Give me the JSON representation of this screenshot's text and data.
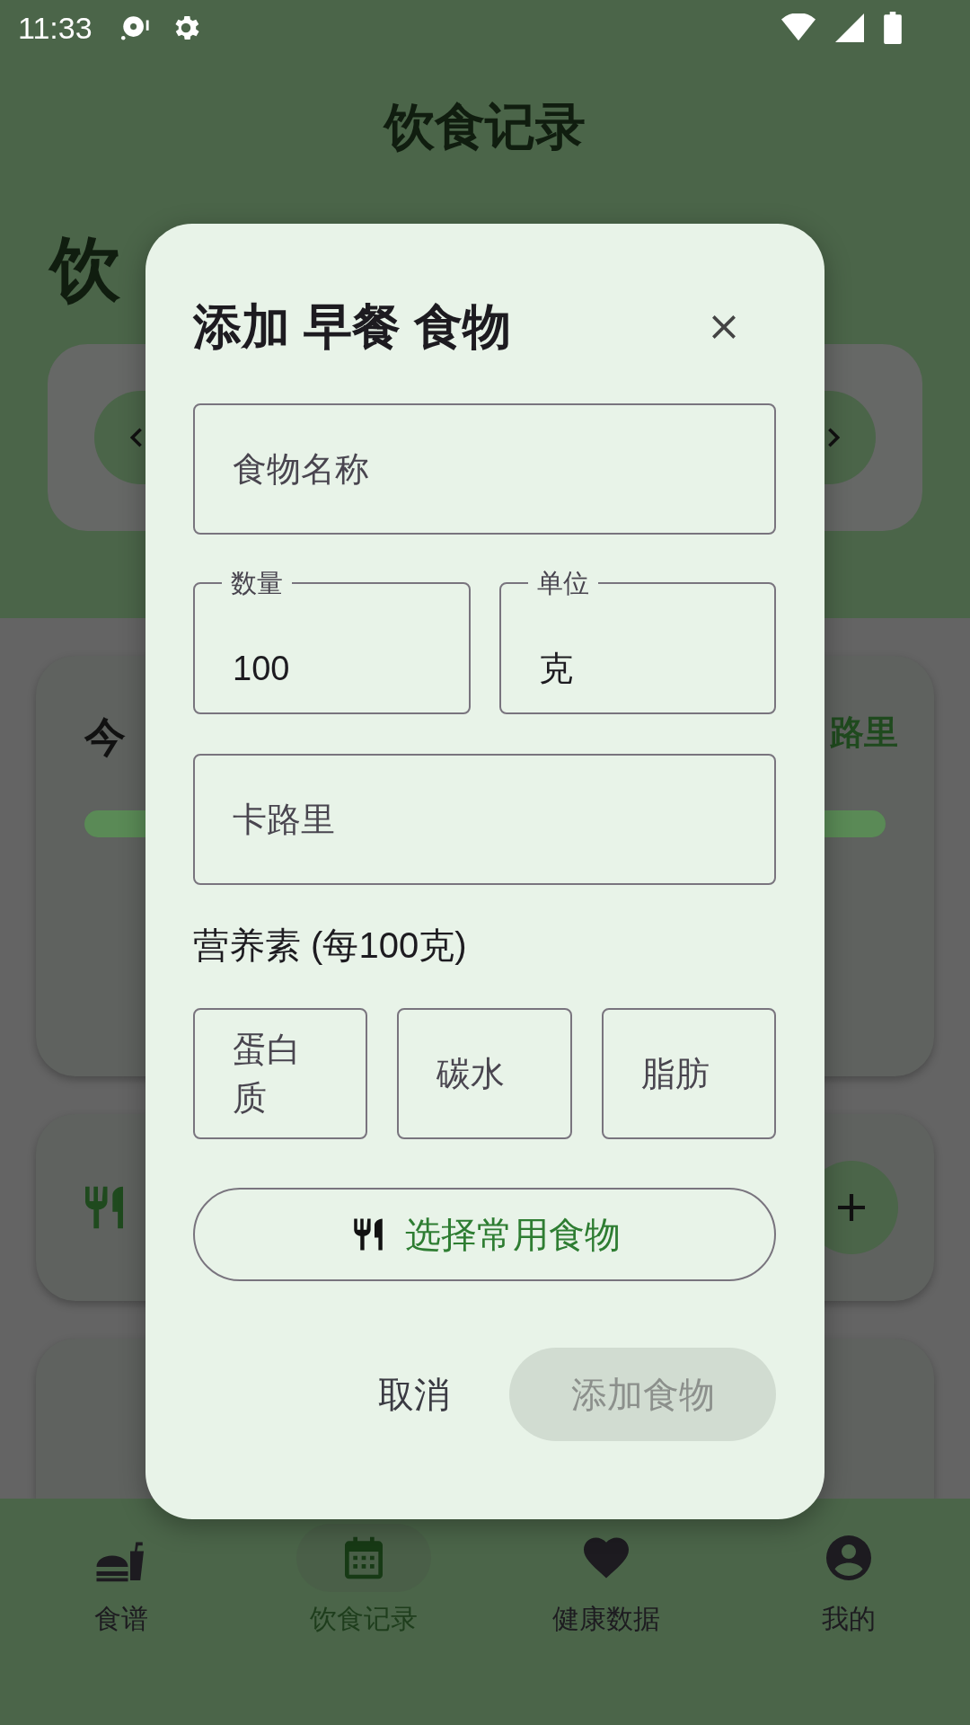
{
  "status_bar": {
    "time": "11:33"
  },
  "app_bar": {
    "title": "饮食记录"
  },
  "background": {
    "headline": "饮",
    "summary_card": {
      "title": "今",
      "calorie_label": "路里",
      "level": 1
    }
  },
  "dialog": {
    "title": "添加 早餐 食物",
    "name_field": {
      "placeholder": "食物名称"
    },
    "amount_fields": [
      {
        "label": "数量",
        "value": "100"
      },
      {
        "label": "单位",
        "value": "克"
      }
    ],
    "calorie_field": {
      "placeholder": "卡路里"
    },
    "nutrients_heading": "营养素 (每100克)",
    "nutrient_fields": [
      {
        "placeholder": "蛋白质"
      },
      {
        "placeholder": "碳水"
      },
      {
        "placeholder": "脂肪"
      }
    ],
    "pick_button": "选择常用食物",
    "cancel_button": "取消",
    "add_button": {
      "label": "添加食物",
      "disabled": true
    }
  },
  "bottom_nav": [
    {
      "kind": "recipes",
      "label": "食谱",
      "selected": false
    },
    {
      "kind": "calendar",
      "label": "饮食记录",
      "selected": true
    },
    {
      "kind": "health",
      "label": "健康数据",
      "selected": false
    },
    {
      "kind": "profile",
      "label": "我的",
      "selected": false
    }
  ]
}
